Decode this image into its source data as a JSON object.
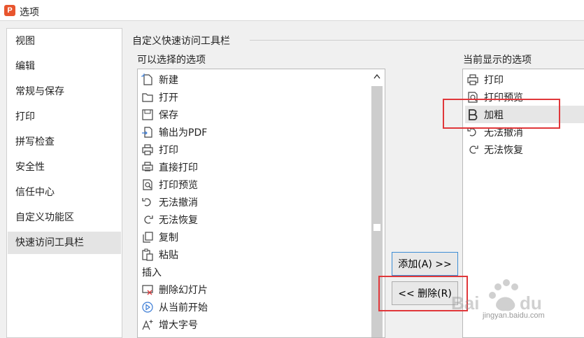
{
  "window": {
    "title": "选项",
    "logo_letter": "P"
  },
  "nav": {
    "items": [
      {
        "label": "视图"
      },
      {
        "label": "编辑"
      },
      {
        "label": "常规与保存"
      },
      {
        "label": "打印"
      },
      {
        "label": "拼写检查"
      },
      {
        "label": "安全性"
      },
      {
        "label": "信任中心"
      },
      {
        "label": "自定义功能区"
      },
      {
        "label": "快速访问工具栏"
      }
    ],
    "active": "快速访问工具栏"
  },
  "main": {
    "group_title": "自定义快速访问工具栏",
    "available_label": "可以选择的选项",
    "current_label": "当前显示的选项",
    "available_items": [
      {
        "label": "新建",
        "icon": "new-file-icon"
      },
      {
        "label": "打开",
        "icon": "folder-open-icon"
      },
      {
        "label": "保存",
        "icon": "save-icon"
      },
      {
        "label": "输出为PDF",
        "icon": "export-pdf-icon"
      },
      {
        "label": "打印",
        "icon": "printer-icon"
      },
      {
        "label": "直接打印",
        "icon": "direct-print-icon"
      },
      {
        "label": "打印预览",
        "icon": "print-preview-icon"
      },
      {
        "label": "无法撤消",
        "icon": "undo-icon"
      },
      {
        "label": "无法恢复",
        "icon": "redo-icon"
      },
      {
        "label": "复制",
        "icon": "copy-icon"
      },
      {
        "label": "粘贴",
        "icon": "paste-icon"
      },
      {
        "label": "插入",
        "icon": ""
      },
      {
        "label": "删除幻灯片",
        "icon": "delete-slide-icon"
      },
      {
        "label": "从当前开始",
        "icon": "play-from-current-icon"
      },
      {
        "label": "增大字号",
        "icon": "increase-font-icon"
      }
    ],
    "current_items": [
      {
        "label": "打印",
        "icon": "printer-icon"
      },
      {
        "label": "打印预览",
        "icon": "print-preview-icon"
      },
      {
        "label": "加粗",
        "icon": "bold-icon"
      },
      {
        "label": "无法撤消",
        "icon": "undo-icon"
      },
      {
        "label": "无法恢复",
        "icon": "redo-icon"
      }
    ],
    "selected_current": "加粗",
    "add_button": "添加(A) >>",
    "remove_button": "<< 删除(R)"
  },
  "watermark": {
    "brand": "Baidu 经验",
    "url": "jingyan.baidu.com"
  },
  "colors": {
    "highlight": "#e0373a",
    "logo": "#e8552e",
    "focus_border": "#3c8dd4"
  }
}
